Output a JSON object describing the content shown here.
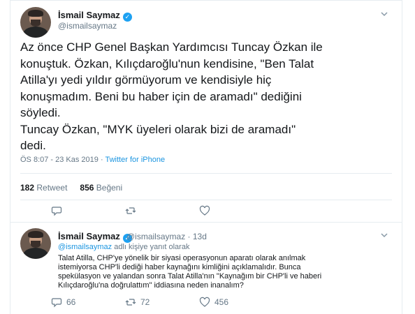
{
  "tweet": {
    "author_name": "İsmail Saymaz",
    "author_handle": "@ismailsaymaz",
    "text": "Az önce CHP Genel Başkan Yardımcısı Tuncay Özkan ile\nkonuştuk. Özkan, Kılıçdaroğlu'nun kendisine, \"Ben Talat\nAtilla'yı yedi yıldır görmüyorum ve kendisiyle hiç\nkonuşmadım. Beni bu haber için de aramadı\" dediğini\nsöyledi.\nTuncay Özkan, \"MYK üyeleri olarak bizi de aramadı\"\ndedi.",
    "timestamp": "ÖS 8:07 - 23 Kas 2019",
    "separator": " · ",
    "source": "Twitter for iPhone",
    "retweets_count": "182",
    "retweets_label": "Retweet",
    "likes_count": "856",
    "likes_label": "Beğeni"
  },
  "reply": {
    "author_name": "İsmail Saymaz",
    "author_handle_time": "@ismailsaymaz · 13d",
    "replying_mention": "@ismailsaymaz",
    "replying_suffix": " adlı kişiye yanıt olarak",
    "text": "Talat Atilla, CHP'ye yönelik bir siyasi operasyonun aparatı olarak anılmak\nistemiyorsa CHP'li dediği haber kaynağını kimliğini açıklamalıdır. Bunca\nspekülasyon ve yalandan sonra Talat Atilla'nın \"Kaynağım bir CHP'li ve haberi\nKılıçdaroğlu'na doğrulattım\" iddiasına neden inanalım?",
    "reply_count": "66",
    "retweet_count": "72",
    "like_count": "456"
  },
  "colors": {
    "accent": "#1da1f2",
    "link": "#1b95e0",
    "muted": "#657786",
    "border": "#e6ecf0"
  },
  "icons": [
    "verified-badge-icon",
    "chevron-down-icon",
    "reply-icon",
    "retweet-icon",
    "heart-icon"
  ]
}
